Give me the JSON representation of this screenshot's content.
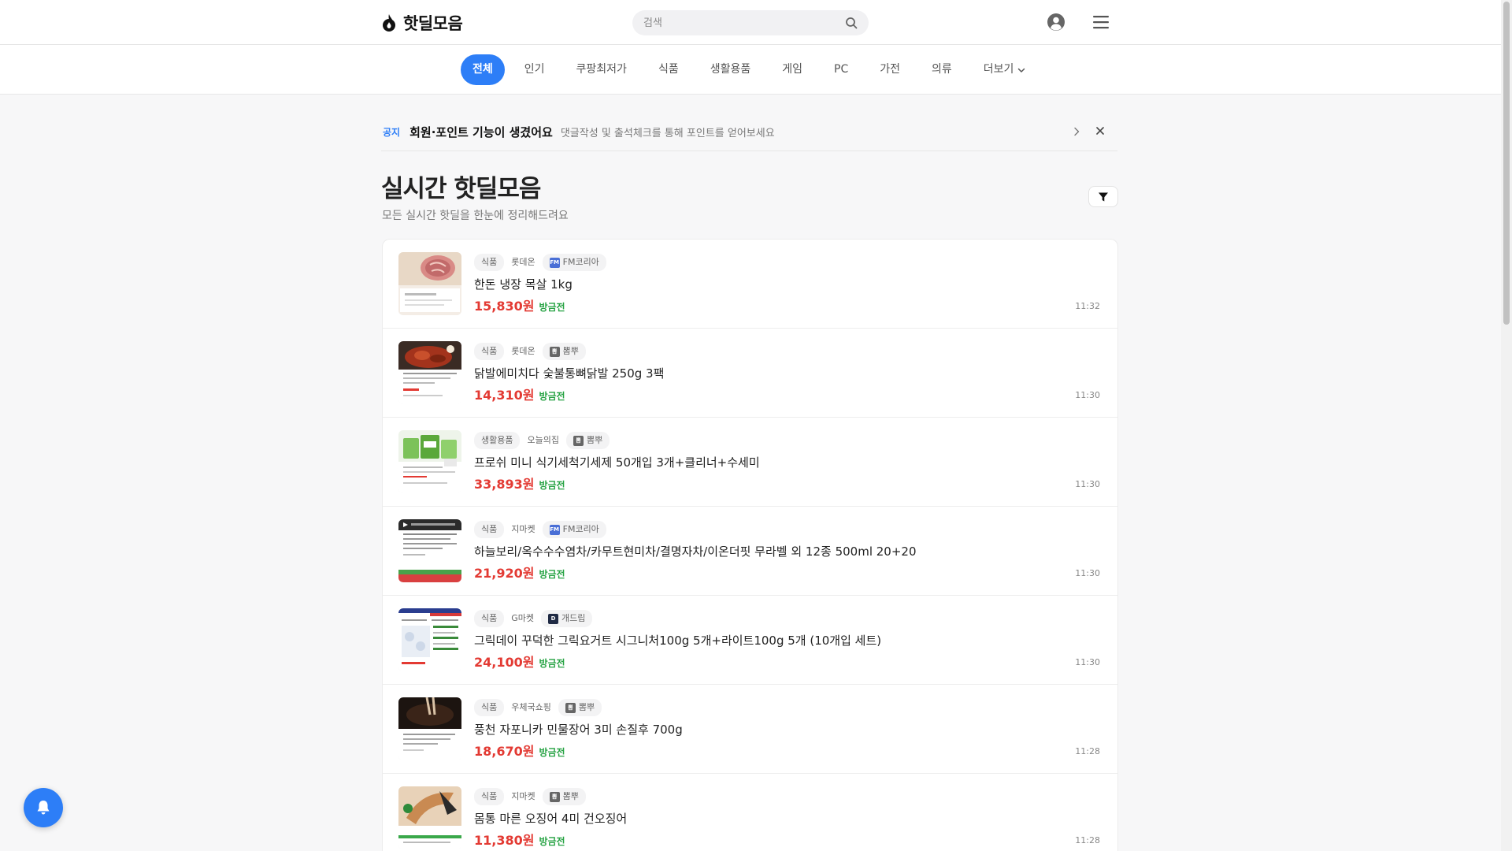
{
  "header": {
    "logo_text": "핫딜모음",
    "search_placeholder": "검색"
  },
  "categories": [
    {
      "label": "전체",
      "active": true
    },
    {
      "label": "인기"
    },
    {
      "label": "쿠팡최저가"
    },
    {
      "label": "식품"
    },
    {
      "label": "생활용품"
    },
    {
      "label": "게임"
    },
    {
      "label": "PC"
    },
    {
      "label": "가전"
    },
    {
      "label": "의류"
    },
    {
      "label": "더보기"
    }
  ],
  "notice": {
    "tag": "공지",
    "title": "회원·포인트 기능이 생겼어요",
    "desc": "댓글작성 및 출석체크를 통해 포인트를 얻어보세요"
  },
  "page": {
    "title": "실시간 핫딜모음",
    "subtitle": "모든 실시간 핫딜을 한눈에 정리해드려요"
  },
  "colors": {
    "accent": "#2d7ef7",
    "price": "#e33a33",
    "status": "#27a344"
  },
  "deals": [
    {
      "category": "식품",
      "store": "롯데온",
      "source": "FM코리아",
      "source_icon": "fm-icon",
      "title": "한돈 냉장 목살 1kg",
      "price": "15,830원",
      "status": "방금전",
      "time": "11:32"
    },
    {
      "category": "식품",
      "store": "롯데온",
      "source": "뽐뿌",
      "source_icon": "ppomppu-icon",
      "title": "닭발에미치다 숯불통뼈닭발 250g 3팩",
      "price": "14,310원",
      "status": "방금전",
      "time": "11:30"
    },
    {
      "category": "생활용품",
      "store": "오늘의집",
      "source": "뽐뿌",
      "source_icon": "ppomppu-icon",
      "title": "프로쉬 미니 식기세척기세제 50개입 3개+클리너+수세미",
      "price": "33,893원",
      "status": "방금전",
      "time": "11:30"
    },
    {
      "category": "식품",
      "store": "지마켓",
      "source": "FM코리아",
      "source_icon": "fm-icon",
      "title": "하늘보리/옥수수수염차/카무트현미차/결명자차/이온더핏 무라벨 외 12종 500ml 20+20",
      "price": "21,920원",
      "status": "방금전",
      "time": "11:30"
    },
    {
      "category": "식품",
      "store": "G마켓",
      "source": "개드립",
      "source_icon": "dogdrip-icon",
      "title": "그릭데이 꾸덕한 그릭요거트 시그니처100g 5개+라이트100g 5개 (10개입 세트)",
      "price": "24,100원",
      "status": "방금전",
      "time": "11:30"
    },
    {
      "category": "식품",
      "store": "우체국쇼핑",
      "source": "뽐뿌",
      "source_icon": "ppomppu-icon",
      "title": "풍천 자포니카 민물장어 3미 손질후 700g",
      "price": "18,670원",
      "status": "방금전",
      "time": "11:28"
    },
    {
      "category": "식품",
      "store": "지마켓",
      "source": "뽐뿌",
      "source_icon": "ppomppu-icon",
      "title": "몸통 마른 오징어 4미 건오징어",
      "price": "11,380원",
      "status": "방금전",
      "time": "11:28"
    }
  ]
}
